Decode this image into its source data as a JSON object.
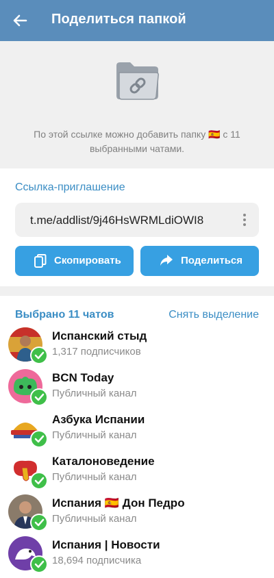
{
  "header": {
    "title": "Поделиться папкой"
  },
  "hero": {
    "text": "По этой ссылке можно добавить папку 🇪🇸 с 11 выбранными чатами."
  },
  "invite": {
    "section_title": "Ссылка-приглашение",
    "link": "t.me/addlist/9j46HsWRMLdiOWI8",
    "copy_label": "Скопировать",
    "share_label": "Поделиться"
  },
  "list": {
    "selected_count": "Выбрано 11 чатов",
    "deselect_label": "Снять выделение",
    "items": [
      {
        "name": "Испанский стыд",
        "sub": "1,317 подписчиков"
      },
      {
        "name": "BCN Today",
        "sub": "Публичный канал"
      },
      {
        "name": "Азбука Испании",
        "sub": "Публичный канал"
      },
      {
        "name": "Каталоноведение",
        "sub": "Публичный канал"
      },
      {
        "name": "Испания 🇪🇸 Дон Педро",
        "sub": "Публичный канал"
      },
      {
        "name": "Испания | Новости",
        "sub": "18,694 подписчика"
      }
    ]
  },
  "colors": {
    "header_bg": "#5a8dbb",
    "accent": "#3a8dc4",
    "button": "#37a0e2",
    "check": "#3fbf49"
  }
}
